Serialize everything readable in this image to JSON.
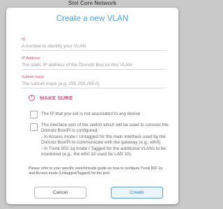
{
  "backdrop": {
    "title": "Stel Core Network"
  },
  "dialog": {
    "title": "Create a new VLAN",
    "fields": {
      "id": {
        "label": "ID",
        "placeholder": "A number to identify your VLAN"
      },
      "ip": {
        "label": "IP Address",
        "placeholder": "The static IP address of the Domotz Box on this VLAN"
      },
      "mask": {
        "label": "Subnet mask",
        "placeholder": "The subnet mask (e.g. 255.255.255.0)"
      }
    },
    "warning": {
      "title": "MAKE SURE"
    },
    "checklist": {
      "item1": "The IP that you set is not associated to any device",
      "item2_lines": [
        "The interface port of the switch which will be used to connect the Domotz Box/Pi is configured:",
        "- In Access mode / Untagged for the main interface used by the Domotz Box/Pi to communicate with the gateway (e.g., eth0)",
        "- In Trunk 802.1q mode / Tagged for the additional VLANs to be monitored (e.g., the eth0.10 used for LAN 10)."
      ]
    },
    "note": "Please refer to your specific switch/model guide on how to configure Trunk 802.1q and Access mode (Untagged/Tagged) for the port.",
    "buttons": {
      "cancel": "Cancel",
      "create": "Create"
    }
  }
}
